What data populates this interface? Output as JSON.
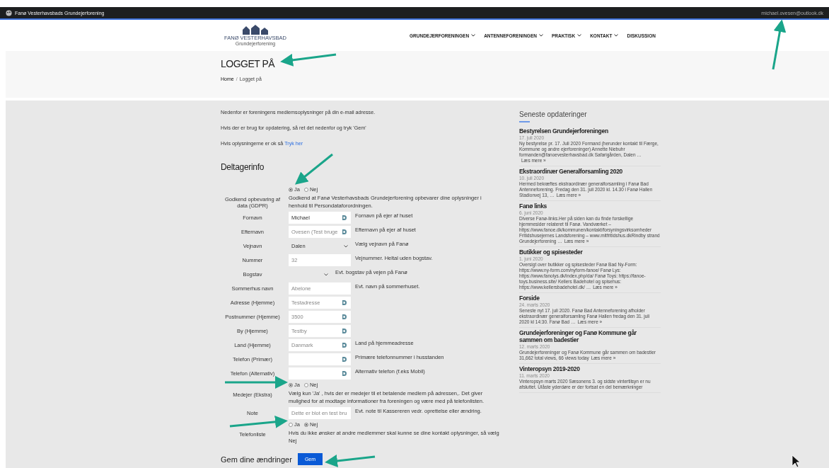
{
  "top_bar": {
    "site_name": "Fanø Vesterhavsbads Grundejerforening",
    "user_email": "michael.ovesen@outlook.dk"
  },
  "header": {
    "logo_text": "FANØ VESTERHAVSBAD",
    "logo_subtext": "Grundejerforening",
    "nav": [
      {
        "label": "GRUNDEJERFORENINGEN",
        "has_submenu": true
      },
      {
        "label": "ANTENNEFORENINGEN",
        "has_submenu": true
      },
      {
        "label": "PRAKTISK",
        "has_submenu": true
      },
      {
        "label": "KONTAKT",
        "has_submenu": true
      },
      {
        "label": "DISKUSSION",
        "has_submenu": false
      }
    ]
  },
  "page_title": "LOGGET PÅ",
  "breadcrumb": [
    {
      "label": "Home",
      "kind": "link"
    },
    {
      "label": "/",
      "kind": "separator"
    },
    {
      "label": "Logget på",
      "kind": "current"
    }
  ],
  "intro": [
    "Nedenfor er foreningens medlemsoplysninger på din e-mail adresse.",
    "Hvis der er brug for opdatering, så ret det nedenfor og tryk 'Gem'"
  ],
  "intro_link_line": {
    "text": "Hvis oplysningerne er ok så",
    "link": "Tryk her"
  },
  "section_title": "Deltagerinfo",
  "fields": [
    {
      "kind": "radio",
      "label": "Godkend opbevaring af data (GDPR)",
      "options": [
        {
          "label": "Ja",
          "selected": true
        },
        {
          "label": "Nej",
          "selected": false
        }
      ],
      "description": "Godkend at Fanø Vesterhavsbads Grundejerforening opbevarer dine oplysninger i henhold til Persondataforordningen."
    },
    {
      "kind": "text",
      "label": "Fornavn",
      "value": "Michael",
      "redacted": false,
      "autofill_icon": true,
      "description": "Fornavn på ejer af huset"
    },
    {
      "kind": "text",
      "label": "Efternavn",
      "value": "Ovesen (Test bruge",
      "redacted": true,
      "autofill_icon": true,
      "description": "Efternavn på ejer af huset"
    },
    {
      "kind": "select",
      "label": "Vejnavn",
      "value": "Dalen",
      "wide": true,
      "description": "Vælg vejnavn på Fanø"
    },
    {
      "kind": "text",
      "label": "Nummer",
      "value": "32",
      "redacted": true,
      "autofill_icon": false,
      "description": "Vejnummer. Heltal uden bogstav."
    },
    {
      "kind": "select",
      "label": "Bogstav",
      "wide": false,
      "description": "Evt. bogstav på vejen på Fanø"
    },
    {
      "kind": "text",
      "label": "Sommerhus navn",
      "value": "Abelone",
      "redacted": true,
      "autofill_icon": false,
      "description": "Evt. navn på sommerhuset."
    },
    {
      "kind": "text",
      "label": "Adresse (Hjemme)",
      "value": "Testadresse",
      "redacted": true,
      "autofill_icon": true
    },
    {
      "kind": "text",
      "label": "Postnummer (Hjemme)",
      "value": "3500",
      "redacted": true,
      "autofill_icon": true
    },
    {
      "kind": "text",
      "label": "By (Hjemme)",
      "value": "Testby",
      "redacted": true,
      "autofill_icon": true
    },
    {
      "kind": "text",
      "label": "Land (Hjemme)",
      "value": "Danmark",
      "redacted": true,
      "autofill_icon": true,
      "description": "Land på hjemmeadresse"
    },
    {
      "kind": "text",
      "label": "Telefon (Primær)",
      "autofill_icon": true,
      "description": "Primære telefonnummer i husstanden"
    },
    {
      "kind": "text",
      "label": "Telefon (Alternativ)",
      "autofill_icon": true,
      "description": "Alternativ telefon (f.eks Mobil)"
    },
    {
      "kind": "radio",
      "label": "Medejer (Ekstra)",
      "options": [
        {
          "label": "Ja",
          "selected": true
        },
        {
          "label": "Nej",
          "selected": false
        }
      ],
      "description": "Vælg kun 'Ja' , hvis der er medejer til et betalende medlem på adressen,. Det giver mulighed for at modtage informationer fra foreningen og være med på telefonlisten."
    },
    {
      "kind": "text",
      "label": "Note",
      "value": "Dette er blot en test bru",
      "redacted": true,
      "autofill_icon": false,
      "description": "Evt. note til Kassereren vedr. oprettelse eller ændring."
    },
    {
      "kind": "radio",
      "label": "Telefonliste",
      "options": [
        {
          "label": "Ja",
          "selected": false
        },
        {
          "label": "Nej",
          "selected": true
        }
      ],
      "description": "Hvis du ikke ønsker at andre medlemmer skal kunne se dine kontakt oplysninger, så vælg Nej"
    }
  ],
  "save": {
    "label": "Gem dine ændringer",
    "button": "Gem"
  },
  "sidebar": {
    "title": "Seneste opdateringer",
    "posts": [
      {
        "title": "Bestyrelsen Grundejerforeningen",
        "date": "17. juli 2020",
        "excerpt": "Ny bestyrelse pr. 17. Juli 2020 Formand (herunder kontakt til Færge, Kommune og andre ejerforeninger) Annette Niebuhr formanden@fanoevesterhavsbad.dk Safarigården, Dalen …",
        "more": "Læs mere »"
      },
      {
        "title": "Ekstraordinær Generalforsamling 2020",
        "date": "10. juli 2020",
        "excerpt": "Hermed bekræftes ekstraordinær generalforsamling i Fanø Bad Antenneforening. Fredag den 31. juli 2020 kl. 14.30 i Fanø Hallen Stadionvej 13, …",
        "more": "Læs mere »"
      },
      {
        "title": "Fanø links",
        "date": "6. juni 2020",
        "excerpt": "Diverse Fanø-links.Her på siden kan du finde forskellige hjemmesider relateret til Fanø. Vandværket – https://www.fanoe.dk/kommunen/kontakt/forsyningsvirksomheder Fritidshusejernes Landsforening – www.mitfritidshus.dkRindby strand Grundejerforening …",
        "more": "Læs mere »"
      },
      {
        "title": "Butikker og spisesteder",
        "date": "1. juni 2020",
        "excerpt": "Oversigt over butikker og spisesteder Fanø Bad Ny-Form: https://www.ny-form.com/nyform-fanoe/ Fanø Lys: https://www.fanolys.dk/index.php/da/ Fanø Toys: https://fanoe-toys.business.site/ Kellers Badehotel og spisehus: https://www.kellersbadehotel.dk/ …",
        "more": "Læs mere »"
      },
      {
        "title": "Forside",
        "date": "24. marts 2020",
        "excerpt": "Seneste nyt 17. juli 2020. Fanø Bad Antenneforening afholder ekstraordinær generalforsamling Fanø Hallen fredag den 31. juli 2020 kl 14:30. Fanø Bad …",
        "more": "Læs mere »"
      },
      {
        "title": "Grundejerforeninger og Fanø Kommune går sammen om badestier",
        "date": "12. marts 2020",
        "excerpt": "Grundejerforeninger og Fanø Kommune går sammen om badestier 31,662 total views, 66 views today",
        "more": "Læs mere »"
      },
      {
        "title": "Vinteropsyn 2019-2020",
        "date": "11. marts 2020",
        "excerpt": "Vinteropsyn marts 2020 Sæsonens 3. og sidste vintertilsyn er nu afsluttet. Ulåste yderdøre er der fortsat en del bemærkninger"
      }
    ]
  }
}
